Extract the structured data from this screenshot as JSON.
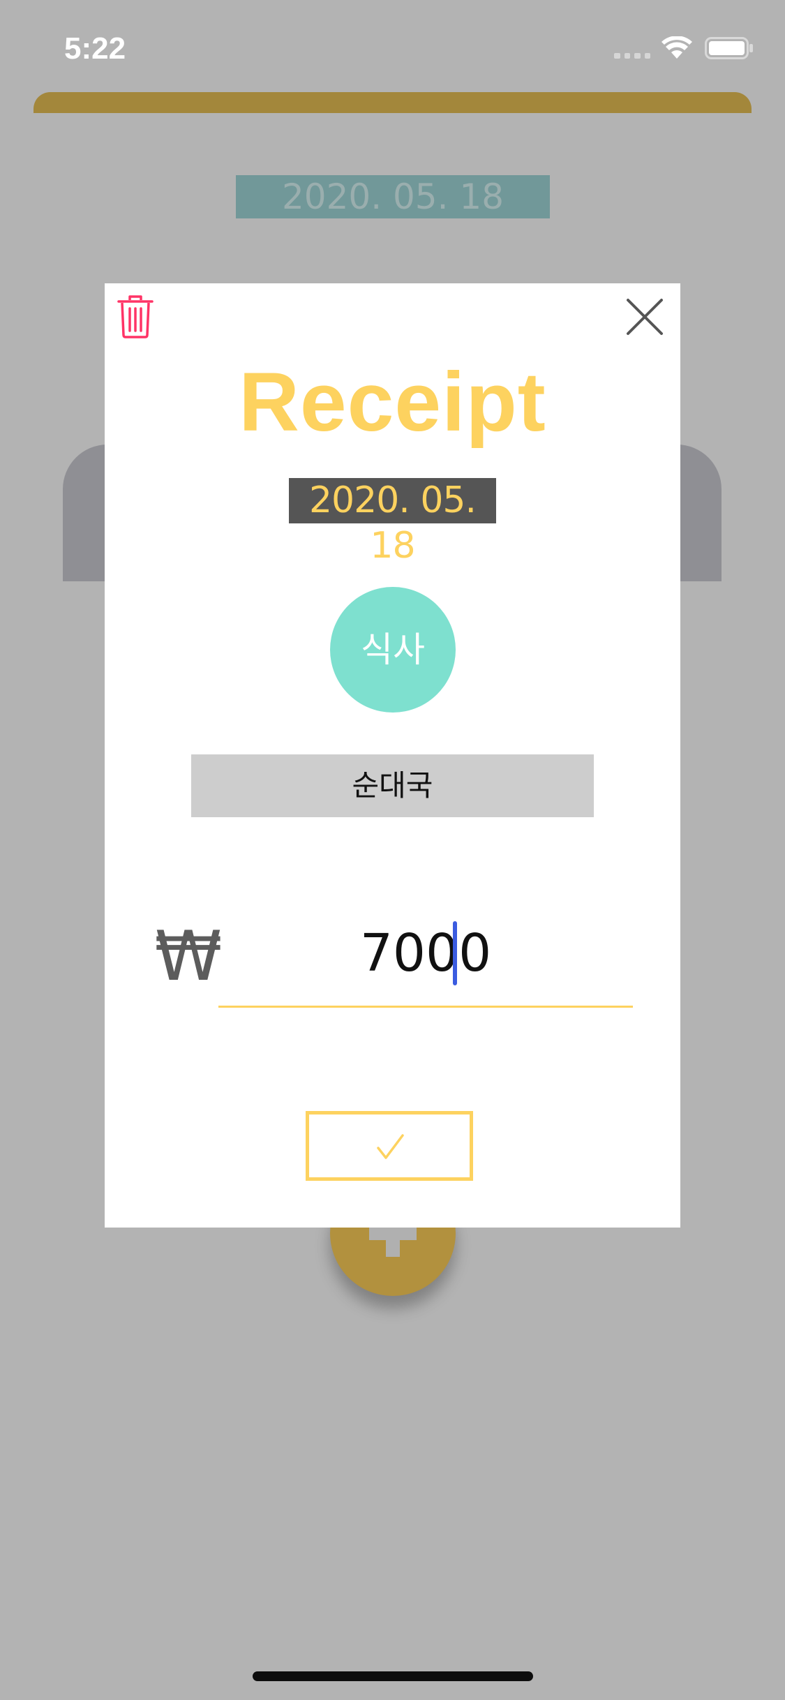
{
  "status_bar": {
    "time": "5:22",
    "wifi_icon": "wifi-icon",
    "battery_icon": "battery-icon",
    "signal_icon": "cellular-signal-icon"
  },
  "background": {
    "date": "2020. 05. 18",
    "add_icon": "plus-icon"
  },
  "modal": {
    "delete_icon": "trash-icon",
    "close_icon": "close-icon",
    "title": "Receipt",
    "date": "2020. 05. 18",
    "category": "식사",
    "item_name": "순대국",
    "currency_symbol": "₩",
    "amount": "7000",
    "confirm_icon": "checkmark-icon"
  },
  "colors": {
    "accent_yellow": "#fdd25f",
    "category_teal": "#7ee0cf",
    "delete_red": "#ff3366",
    "overlay_gray": "#b3b3b3",
    "caret_blue": "#3b5ce0"
  }
}
